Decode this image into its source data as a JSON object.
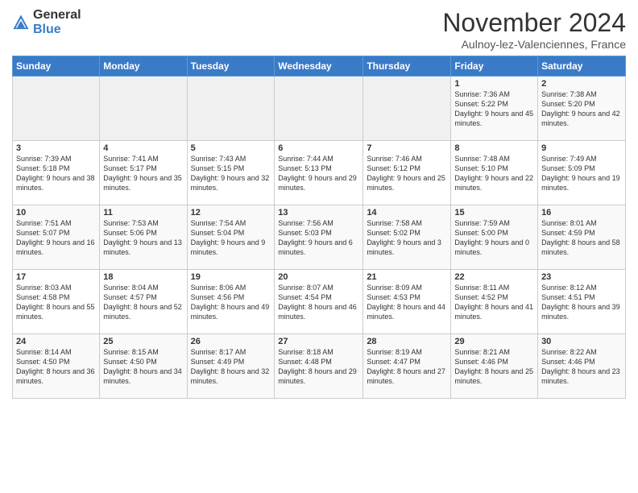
{
  "logo": {
    "general": "General",
    "blue": "Blue"
  },
  "header": {
    "month": "November 2024",
    "location": "Aulnoy-lez-Valenciennes, France"
  },
  "days_of_week": [
    "Sunday",
    "Monday",
    "Tuesday",
    "Wednesday",
    "Thursday",
    "Friday",
    "Saturday"
  ],
  "weeks": [
    [
      {
        "day": "",
        "info": ""
      },
      {
        "day": "",
        "info": ""
      },
      {
        "day": "",
        "info": ""
      },
      {
        "day": "",
        "info": ""
      },
      {
        "day": "",
        "info": ""
      },
      {
        "day": "1",
        "info": "Sunrise: 7:36 AM\nSunset: 5:22 PM\nDaylight: 9 hours and 45 minutes."
      },
      {
        "day": "2",
        "info": "Sunrise: 7:38 AM\nSunset: 5:20 PM\nDaylight: 9 hours and 42 minutes."
      }
    ],
    [
      {
        "day": "3",
        "info": "Sunrise: 7:39 AM\nSunset: 5:18 PM\nDaylight: 9 hours and 38 minutes."
      },
      {
        "day": "4",
        "info": "Sunrise: 7:41 AM\nSunset: 5:17 PM\nDaylight: 9 hours and 35 minutes."
      },
      {
        "day": "5",
        "info": "Sunrise: 7:43 AM\nSunset: 5:15 PM\nDaylight: 9 hours and 32 minutes."
      },
      {
        "day": "6",
        "info": "Sunrise: 7:44 AM\nSunset: 5:13 PM\nDaylight: 9 hours and 29 minutes."
      },
      {
        "day": "7",
        "info": "Sunrise: 7:46 AM\nSunset: 5:12 PM\nDaylight: 9 hours and 25 minutes."
      },
      {
        "day": "8",
        "info": "Sunrise: 7:48 AM\nSunset: 5:10 PM\nDaylight: 9 hours and 22 minutes."
      },
      {
        "day": "9",
        "info": "Sunrise: 7:49 AM\nSunset: 5:09 PM\nDaylight: 9 hours and 19 minutes."
      }
    ],
    [
      {
        "day": "10",
        "info": "Sunrise: 7:51 AM\nSunset: 5:07 PM\nDaylight: 9 hours and 16 minutes."
      },
      {
        "day": "11",
        "info": "Sunrise: 7:53 AM\nSunset: 5:06 PM\nDaylight: 9 hours and 13 minutes."
      },
      {
        "day": "12",
        "info": "Sunrise: 7:54 AM\nSunset: 5:04 PM\nDaylight: 9 hours and 9 minutes."
      },
      {
        "day": "13",
        "info": "Sunrise: 7:56 AM\nSunset: 5:03 PM\nDaylight: 9 hours and 6 minutes."
      },
      {
        "day": "14",
        "info": "Sunrise: 7:58 AM\nSunset: 5:02 PM\nDaylight: 9 hours and 3 minutes."
      },
      {
        "day": "15",
        "info": "Sunrise: 7:59 AM\nSunset: 5:00 PM\nDaylight: 9 hours and 0 minutes."
      },
      {
        "day": "16",
        "info": "Sunrise: 8:01 AM\nSunset: 4:59 PM\nDaylight: 8 hours and 58 minutes."
      }
    ],
    [
      {
        "day": "17",
        "info": "Sunrise: 8:03 AM\nSunset: 4:58 PM\nDaylight: 8 hours and 55 minutes."
      },
      {
        "day": "18",
        "info": "Sunrise: 8:04 AM\nSunset: 4:57 PM\nDaylight: 8 hours and 52 minutes."
      },
      {
        "day": "19",
        "info": "Sunrise: 8:06 AM\nSunset: 4:56 PM\nDaylight: 8 hours and 49 minutes."
      },
      {
        "day": "20",
        "info": "Sunrise: 8:07 AM\nSunset: 4:54 PM\nDaylight: 8 hours and 46 minutes."
      },
      {
        "day": "21",
        "info": "Sunrise: 8:09 AM\nSunset: 4:53 PM\nDaylight: 8 hours and 44 minutes."
      },
      {
        "day": "22",
        "info": "Sunrise: 8:11 AM\nSunset: 4:52 PM\nDaylight: 8 hours and 41 minutes."
      },
      {
        "day": "23",
        "info": "Sunrise: 8:12 AM\nSunset: 4:51 PM\nDaylight: 8 hours and 39 minutes."
      }
    ],
    [
      {
        "day": "24",
        "info": "Sunrise: 8:14 AM\nSunset: 4:50 PM\nDaylight: 8 hours and 36 minutes."
      },
      {
        "day": "25",
        "info": "Sunrise: 8:15 AM\nSunset: 4:50 PM\nDaylight: 8 hours and 34 minutes."
      },
      {
        "day": "26",
        "info": "Sunrise: 8:17 AM\nSunset: 4:49 PM\nDaylight: 8 hours and 32 minutes."
      },
      {
        "day": "27",
        "info": "Sunrise: 8:18 AM\nSunset: 4:48 PM\nDaylight: 8 hours and 29 minutes."
      },
      {
        "day": "28",
        "info": "Sunrise: 8:19 AM\nSunset: 4:47 PM\nDaylight: 8 hours and 27 minutes."
      },
      {
        "day": "29",
        "info": "Sunrise: 8:21 AM\nSunset: 4:46 PM\nDaylight: 8 hours and 25 minutes."
      },
      {
        "day": "30",
        "info": "Sunrise: 8:22 AM\nSunset: 4:46 PM\nDaylight: 8 hours and 23 minutes."
      }
    ]
  ]
}
